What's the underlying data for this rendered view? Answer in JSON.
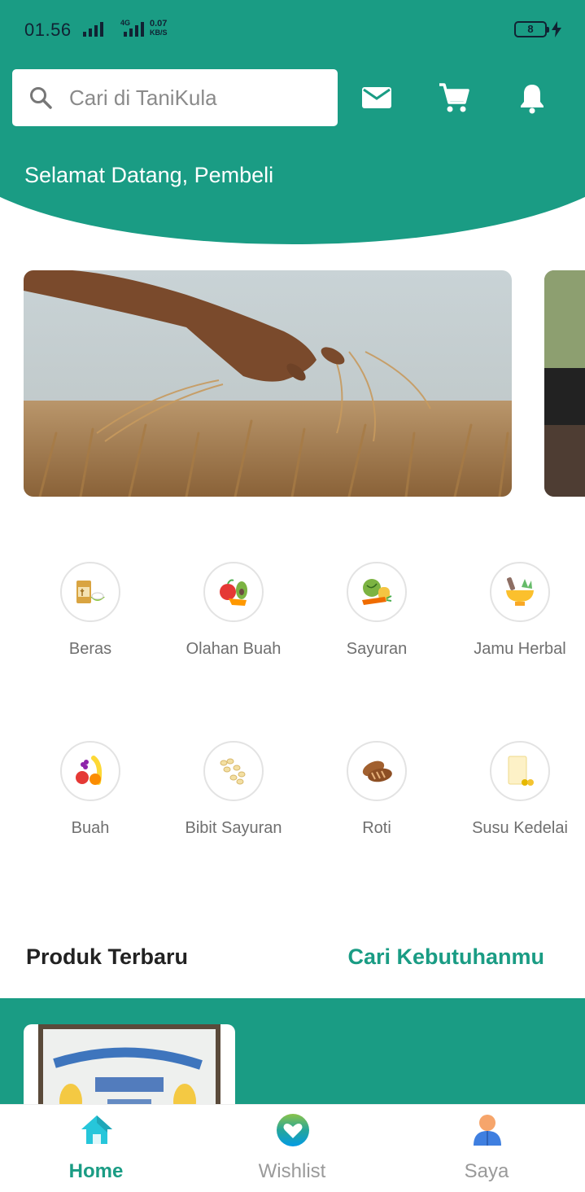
{
  "status_bar": {
    "time": "01.56",
    "network": "4G",
    "speed_value": "0.07",
    "speed_unit": "KB/S",
    "battery": "8"
  },
  "header": {
    "search_placeholder": "Cari di TaniKula",
    "icons": [
      "mail-icon",
      "cart-icon",
      "bell-icon"
    ],
    "welcome": "Selamat Datang, Pembeli"
  },
  "categories": [
    {
      "label": "Beras",
      "icon": "rice-icon"
    },
    {
      "label": "Olahan Buah",
      "icon": "processed-fruit-icon"
    },
    {
      "label": "Sayuran",
      "icon": "vegetables-icon"
    },
    {
      "label": "Jamu Herbal",
      "icon": "herbal-mortar-icon"
    },
    {
      "label": "Buah",
      "icon": "fruit-icon"
    },
    {
      "label": "Bibit Sayuran",
      "icon": "seeds-icon"
    },
    {
      "label": "Roti",
      "icon": "bread-icon"
    },
    {
      "label": "Susu Kedelai",
      "icon": "soy-milk-icon"
    }
  ],
  "products": {
    "title": "Produk Terbaru",
    "link": "Cari Kebutuhanmu"
  },
  "bottom_nav": [
    {
      "label": "Home",
      "icon": "home-icon",
      "active": true
    },
    {
      "label": "Wishlist",
      "icon": "heart-icon",
      "active": false
    },
    {
      "label": "Saya",
      "icon": "user-icon",
      "active": false
    }
  ],
  "colors": {
    "primary": "#1a9c84",
    "text_muted": "#6f6f6f"
  }
}
